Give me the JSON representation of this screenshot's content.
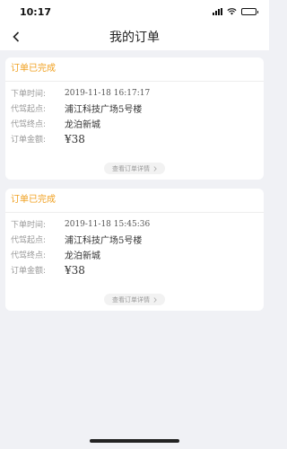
{
  "status_bar": {
    "time": "10:17",
    "battery_level": 0.8
  },
  "header": {
    "title": "我的订单",
    "back_icon": "chevron-left-icon"
  },
  "labels": {
    "order_time": "下单时间:",
    "start": "代驾起点:",
    "end": "代驾终点:",
    "amount": "订单金额:",
    "detail": "查看订单详情"
  },
  "orders": [
    {
      "status": "订单已完成",
      "time": "2019-11-18 16:17:17",
      "start": "浦江科技广场5号楼",
      "end": "龙泊新城",
      "amount": "¥38"
    },
    {
      "status": "订单已完成",
      "time": "2019-11-18 15:45:36",
      "start": "浦江科技广场5号楼",
      "end": "龙泊新城",
      "amount": "¥38"
    }
  ],
  "colors": {
    "status_text": "#f0a020",
    "background": "#f0f1f5"
  }
}
